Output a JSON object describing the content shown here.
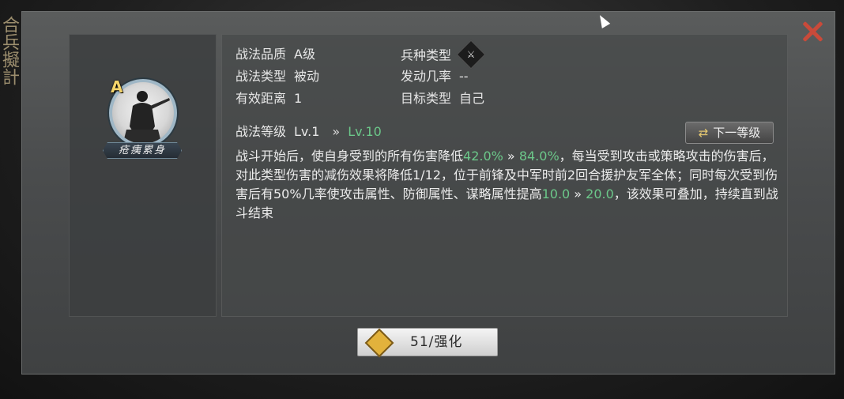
{
  "side_text": "合兵擬計",
  "portrait": {
    "grade": "A",
    "skill_name": "疮痍累身"
  },
  "attributes": {
    "quality_label": "战法品质",
    "quality_value": "A级",
    "type_label": "战法类型",
    "type_value": "被动",
    "range_label": "有效距离",
    "range_value": "1",
    "troop_label": "兵种类型",
    "troop_icon": "troop-type-icon",
    "trigger_label": "发动几率",
    "trigger_value": "--",
    "target_label": "目标类型",
    "target_value": "自己"
  },
  "level": {
    "label": "战法等级",
    "current": "Lv.1",
    "arrow": "»",
    "next": "Lv.10",
    "next_button": "下一等级"
  },
  "description": {
    "p1": "战斗开始后，使自身受到的所有伤害降低",
    "v1a": "42.0%",
    "arrow1": " » ",
    "v1b": "84.0%",
    "p2": "，每当受到攻击或策略攻击的伤害后，对此类型伤害的减伤效果将降低1/12，位于前锋及中军时前2回合援护友军全体；同时每次受到伤害后有50%几率使攻击属性、防御属性、谋略属性提高",
    "v2a": "10.0",
    "arrow2": " » ",
    "v2b": "20.0",
    "p3": "，该效果可叠加，持续直到战斗结束"
  },
  "enhance": {
    "label": "51/强化"
  },
  "colors": {
    "highlight": "#6cc88a",
    "close": "#c94a3a",
    "grade": "#f3d36a"
  }
}
